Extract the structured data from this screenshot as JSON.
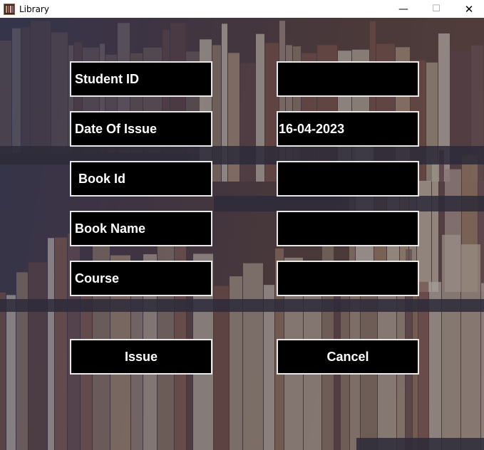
{
  "window": {
    "title": "Library",
    "minimize_symbol": "—",
    "maximize_symbol": "☐",
    "close_symbol": "✕"
  },
  "form": {
    "student_id_label": "Student ID",
    "student_id_value": "",
    "date_label": "Date Of Issue",
    "date_value": "16-04-2023",
    "book_id_label": " Book Id",
    "book_id_value": "",
    "book_name_label": "Book Name",
    "book_name_value": "",
    "course_label": "Course",
    "course_value": ""
  },
  "buttons": {
    "issue": "Issue",
    "cancel": "Cancel"
  },
  "colors": {
    "field_bg": "#000000",
    "field_border": "#e8e8e8",
    "text": "#ffffff"
  }
}
